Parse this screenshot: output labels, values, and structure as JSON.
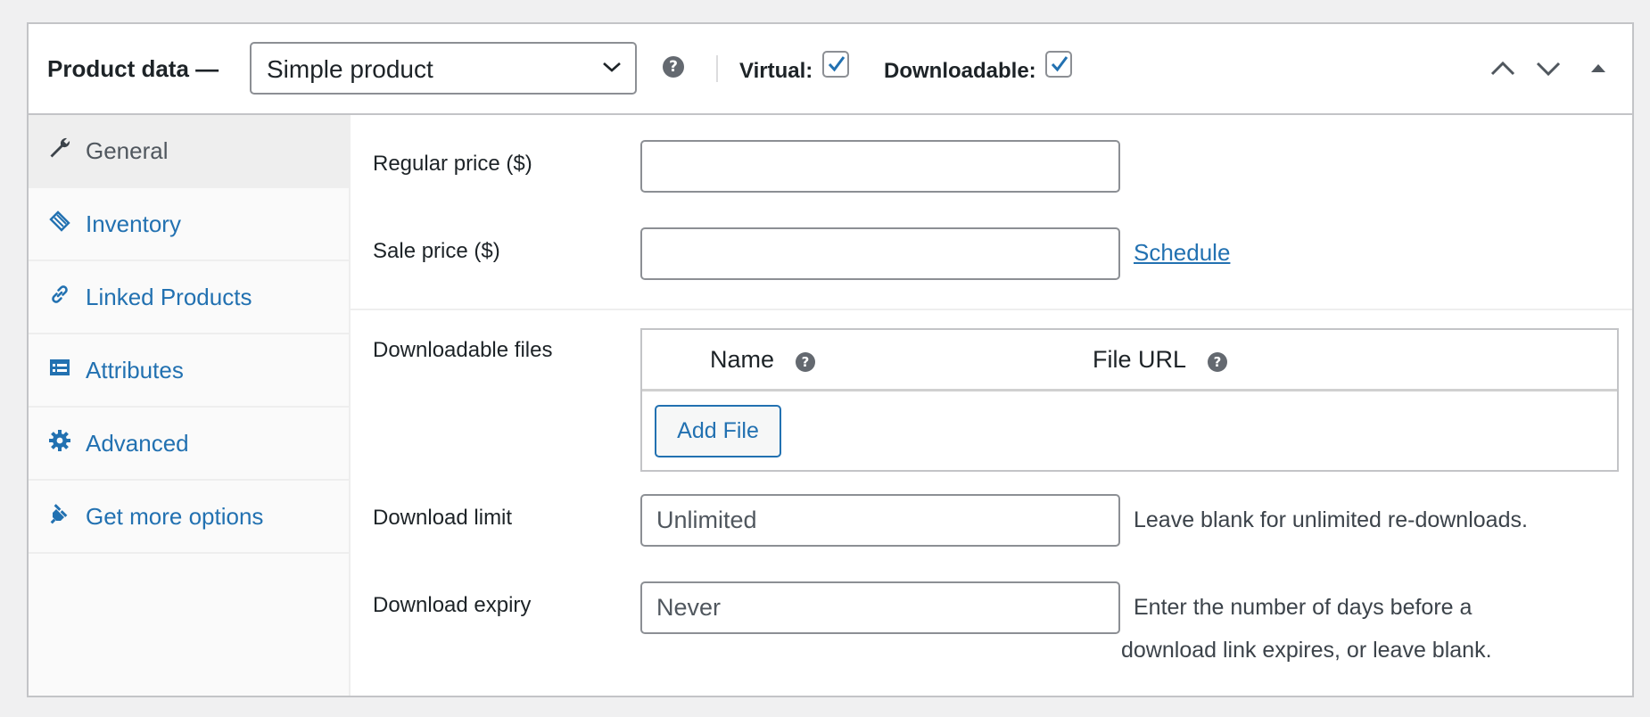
{
  "header": {
    "title": "Product data —",
    "product_type": {
      "selected": "Simple product",
      "options": [
        "Simple product"
      ]
    },
    "help_icon": "?",
    "virtual": {
      "label": "Virtual:",
      "checked": true
    },
    "downloadable": {
      "label": "Downloadable:",
      "checked": true
    },
    "buttons": [
      "chevron-up-icon",
      "chevron-down-icon",
      "collapse-triangle-icon"
    ]
  },
  "sidebar": {
    "tabs": [
      {
        "label": "General",
        "icon": "wrench-icon",
        "active": true
      },
      {
        "label": "Inventory",
        "icon": "tag-icon",
        "active": false
      },
      {
        "label": "Linked Products",
        "icon": "link-icon",
        "active": false
      },
      {
        "label": "Attributes",
        "icon": "list-icon",
        "active": false
      },
      {
        "label": "Advanced",
        "icon": "gear-icon",
        "active": false
      },
      {
        "label": "Get more options",
        "icon": "plugin-icon",
        "active": false
      }
    ]
  },
  "general": {
    "regular_price": {
      "label": "Regular price ($)",
      "value": "",
      "placeholder": ""
    },
    "sale_price": {
      "label": "Sale price ($)",
      "value": "",
      "placeholder": ""
    },
    "schedule_link": "Schedule",
    "downloadable_files": {
      "label": "Downloadable files",
      "columns": [
        "Name",
        "File URL"
      ],
      "help_icon": "?",
      "add_button": "Add File"
    },
    "download_limit": {
      "label": "Download limit",
      "placeholder": "Unlimited",
      "description": "Leave blank for unlimited re-downloads."
    },
    "download_expiry": {
      "label": "Download expiry",
      "placeholder": "Never",
      "description_line1": "Enter the number of days before a",
      "description_line2": "download link expires, or leave blank."
    }
  },
  "colors": {
    "accent": "#2271b1",
    "text": "#1d2327",
    "border": "#c3c4c7",
    "sidebar_bg": "#fafafa",
    "active_tab_bg": "#eeeeee"
  }
}
